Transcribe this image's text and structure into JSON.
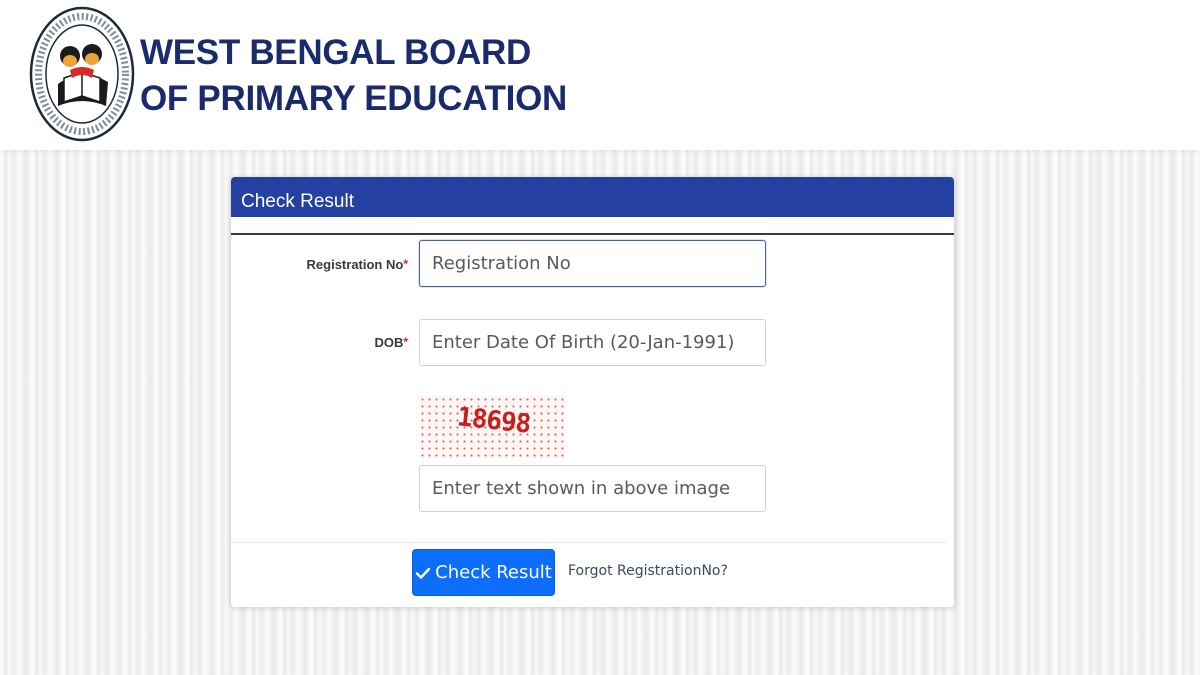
{
  "header": {
    "logo_icon": "wbbpe-emblem-icon",
    "title_line1": "WEST BENGAL BOARD",
    "title_line2": "OF PRIMARY EDUCATION",
    "title_color": "#1a2b6d"
  },
  "form": {
    "heading": "Check Result",
    "heading_bg": "#2441a2",
    "registration": {
      "label": "Registration No",
      "required_mark": "*",
      "placeholder": "Registration No",
      "value": ""
    },
    "dob": {
      "label": "DOB",
      "required_mark": "*",
      "placeholder": "Enter Date Of Birth (20-Jan-1991)",
      "value": ""
    },
    "captcha": {
      "image_text": "18698",
      "placeholder": "Enter text shown in above image",
      "value": ""
    },
    "submit": {
      "icon": "check-icon",
      "label": "Check Result",
      "color": "#0d6efd"
    },
    "forgot_link": "Forgot RegistrationNo?"
  }
}
